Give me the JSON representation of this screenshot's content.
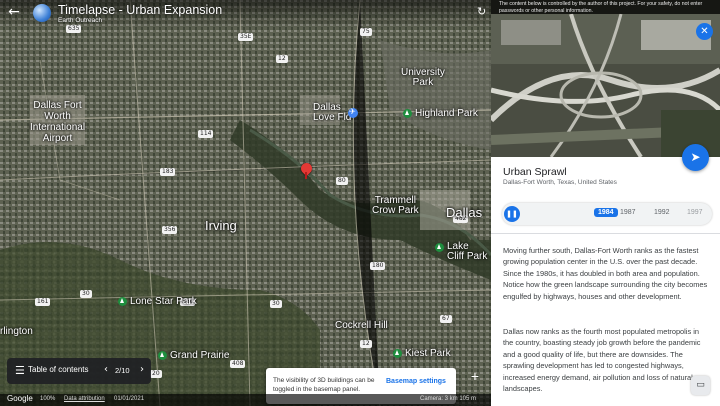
{
  "header": {
    "project_title": "Timelapse - Urban Expansion",
    "project_subtitle": "Earth Outreach",
    "back_icon": "arrow-back-icon",
    "history_icon": "history-icon"
  },
  "map": {
    "labels": {
      "university_park": "University\nPark",
      "highland_park": "Highland Park",
      "dallas_love_field": "Dallas\nLove Fld",
      "dfw_airport": "Dallas Fort\nWorth\nInternational\nAirport",
      "irving": "Irving",
      "dallas": "Dallas",
      "trammell_crow_park": "Trammell\nCrow Park",
      "lake_cliff_park": "Lake\nCliff Park",
      "lone_star_park": "Lone Star Park",
      "cockrell_hill": "Cockrell Hill",
      "grand_prairie": "Grand Prairie",
      "kiest_park": "Kiest Park",
      "arlington": "rlington"
    },
    "shields": [
      "635",
      "183",
      "35E",
      "75",
      "12",
      "114",
      "161",
      "30",
      "360",
      "80",
      "12",
      "408",
      "67",
      "20",
      "30",
      "356",
      "482",
      "180"
    ]
  },
  "toc": {
    "label": "Table of contents",
    "page": "2/10"
  },
  "toast": {
    "text": "The visibility of 3D buildings can be toggled in the basemap panel.",
    "button": "Basemap settings"
  },
  "statusbar": {
    "logo": "Google",
    "zoom": "100%",
    "attribution": "Data attribution",
    "date": "01/01/2021",
    "right": "Camera: 3 km  105 m"
  },
  "panel": {
    "disclaimer": "The content below is controlled by the author of this project. For your safety, do not enter passwords or other personal information.",
    "place_title": "Urban Sprawl",
    "place_subtitle": "Dallas-Fort Worth, Texas, United States",
    "years": [
      "1984",
      "1987",
      "1992",
      "1997"
    ],
    "active_year": "1984",
    "paragraph1": "Moving further south, Dallas-Fort Worth ranks as the fastest growing population center in the U.S. over the past decade. Since the 1980s, it has doubled in both area and population. Notice how the green landscape surrounding the city becomes engulfed by highways, houses and other development.",
    "paragraph2": "Dallas now ranks as the fourth most populated metropolis in the country, boasting steady job growth before the pandemic and a good quality of life, but there are downsides. The sprawling development has led to congested highways, increased energy demand, air pollution and loss of natural landscapes."
  },
  "colors": {
    "accent": "#1a73e8",
    "pin": "#e53935",
    "park": "#1e8e3e"
  }
}
